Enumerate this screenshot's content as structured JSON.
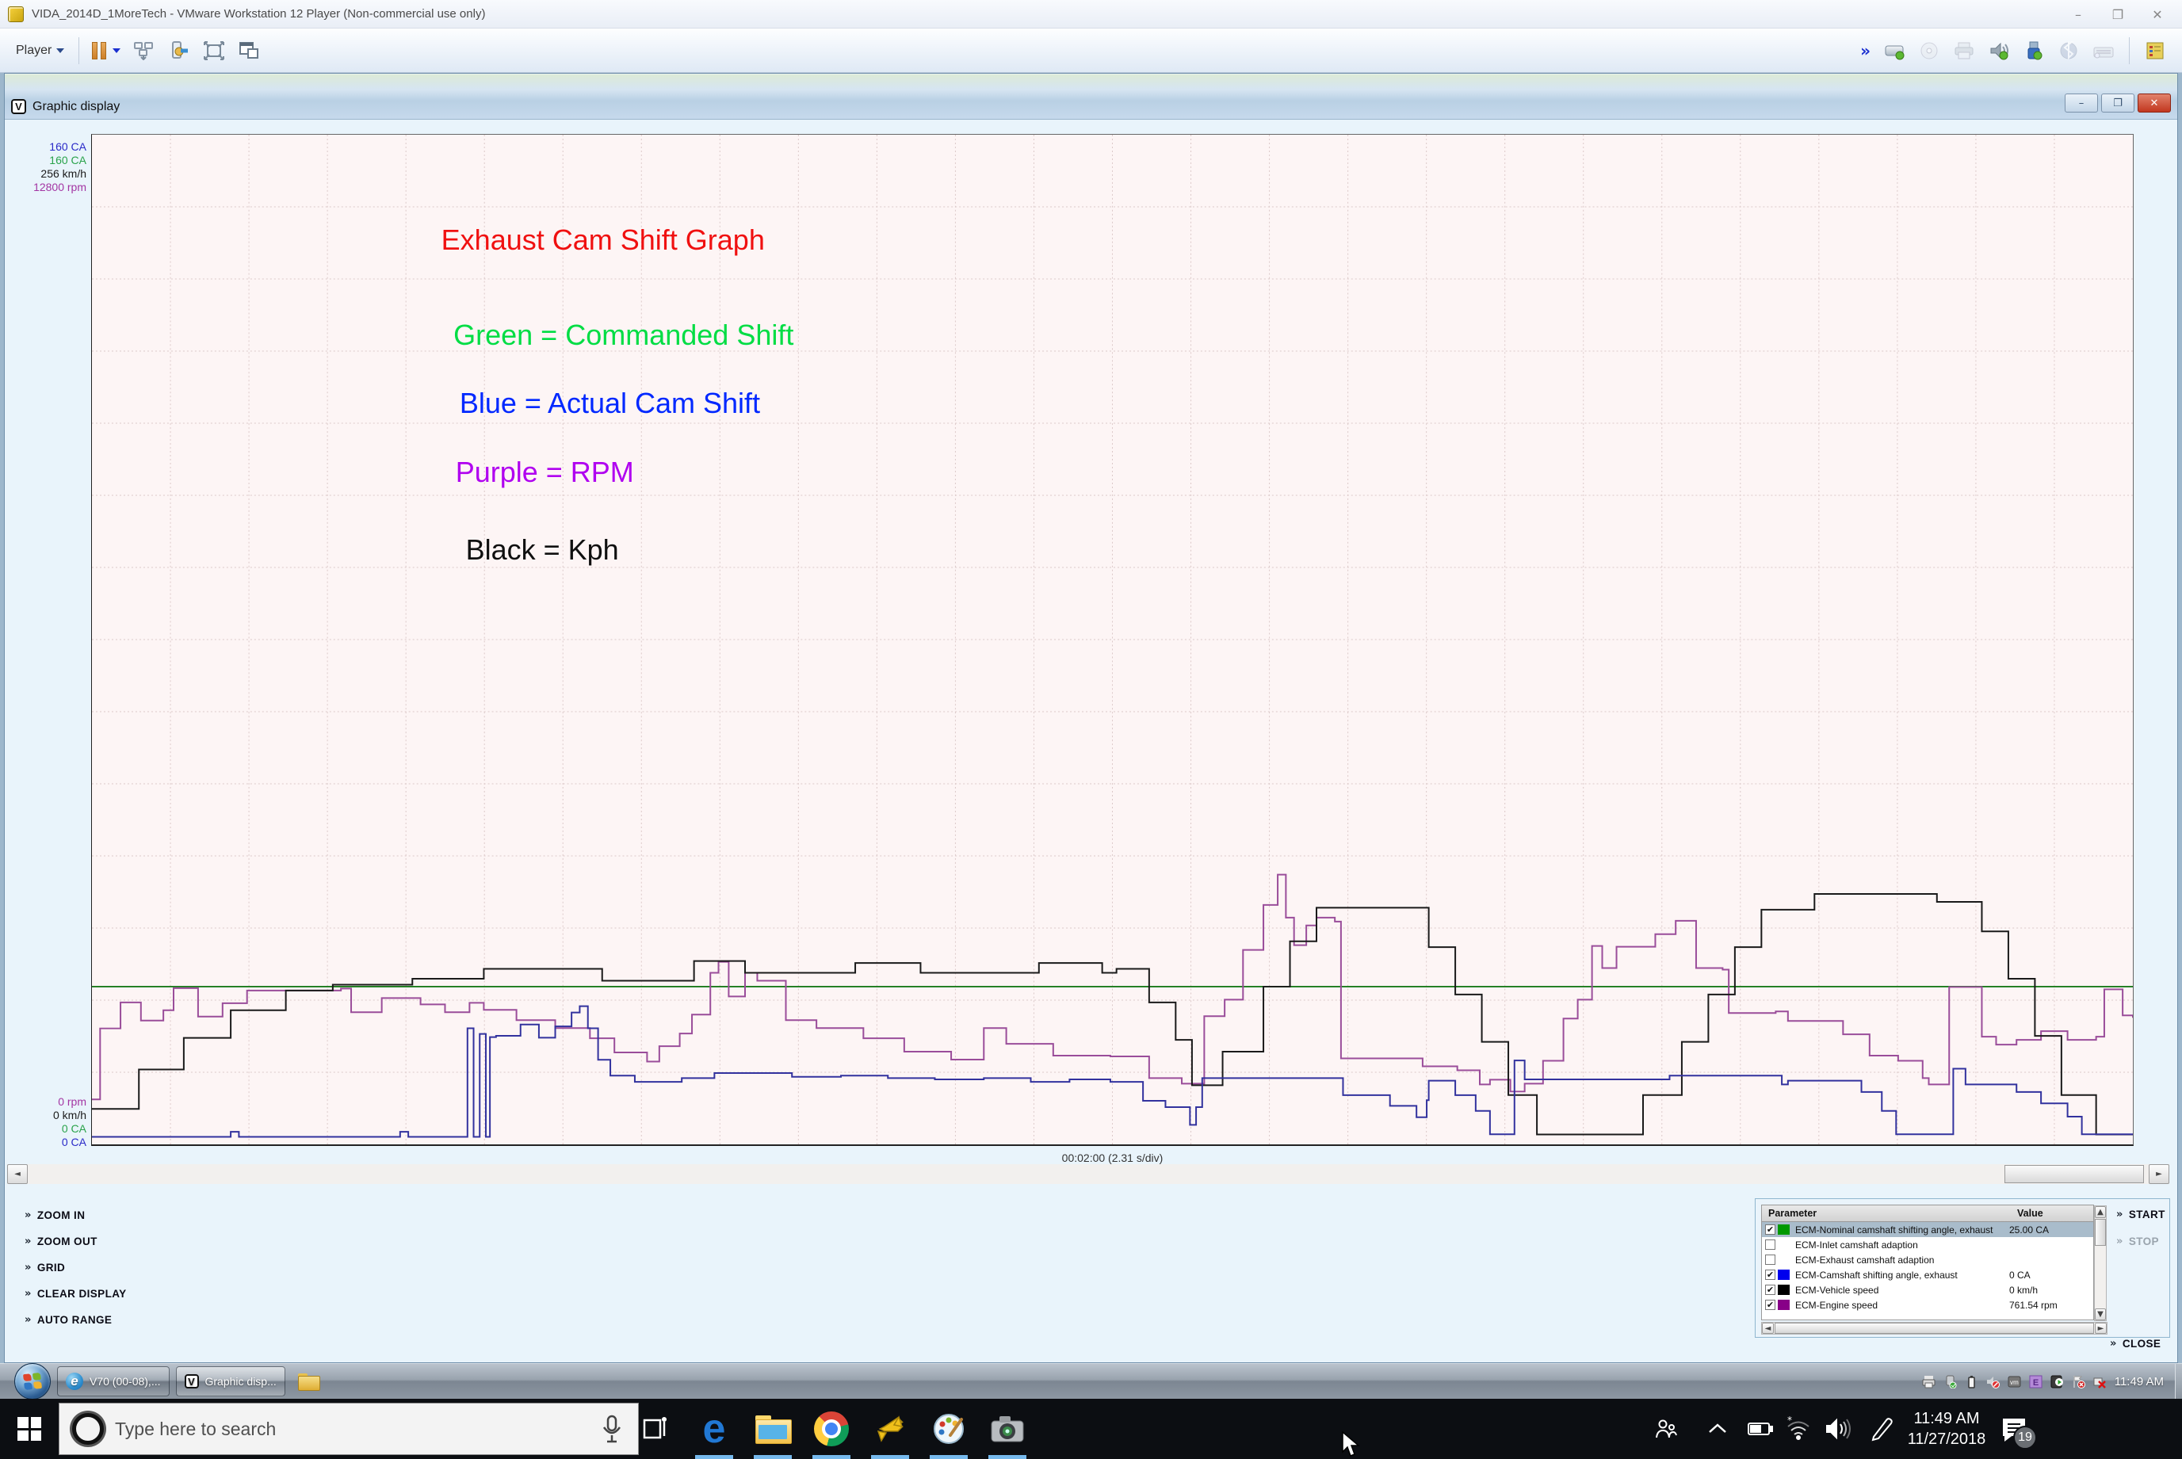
{
  "vmware": {
    "title": "VIDA_2014D_1MoreTech - VMware Workstation 12 Player (Non-commercial use only)",
    "menu_label": "Player",
    "window_controls": {
      "minimize": "–",
      "maximize": "❐",
      "close": "✕"
    },
    "toolbar_icons": [
      "pause-icon",
      "ctrl-alt-del-icon",
      "devices-icon",
      "fullscreen-icon",
      "unity-icon",
      "expand-toolbar-icon",
      "hard-disk-icon",
      "cd-icon",
      "printer-icon",
      "sound-icon",
      "usb-icon",
      "bluetooth-icon",
      "keyboard-icon",
      "tools-note-icon"
    ]
  },
  "graphic_display": {
    "title": "Graphic display",
    "window_controls": {
      "minimize": "–",
      "restore": "❐",
      "close": "✕"
    },
    "axis_top": [
      {
        "text": "160 CA",
        "color": "#2a2ac8"
      },
      {
        "text": "160 CA",
        "color": "#2aa34b"
      },
      {
        "text": "256 km/h",
        "color": "#1a1a1a"
      },
      {
        "text": "12800 rpm",
        "color": "#a335a3"
      }
    ],
    "axis_bottom": [
      {
        "text": "0 rpm",
        "color": "#a335a3"
      },
      {
        "text": "0 km/h",
        "color": "#1a1a1a"
      },
      {
        "text": "0 CA",
        "color": "#2aa34b"
      },
      {
        "text": "0 CA",
        "color": "#2a2ac8"
      }
    ],
    "x_caption": "00:02:00 (2.31 s/div)",
    "buttons": [
      "ZOOM IN",
      "ZOOM OUT",
      "GRID",
      "CLEAR DISPLAY",
      "AUTO RANGE"
    ],
    "start_label": "START",
    "stop_label": "STOP",
    "close_label": "CLOSE",
    "table": {
      "headers": [
        "Parameter",
        "Value"
      ],
      "rows": [
        {
          "checked": true,
          "swatch": "#009900",
          "param": "ECM-Nominal camshaft shifting angle, exhaust",
          "value": "25.00 CA",
          "selected": true
        },
        {
          "checked": false,
          "swatch": null,
          "param": "ECM-Inlet camshaft adaption",
          "value": "",
          "selected": false
        },
        {
          "checked": false,
          "swatch": null,
          "param": "ECM-Exhaust camshaft adaption",
          "value": "",
          "selected": false
        },
        {
          "checked": true,
          "swatch": "#0000ee",
          "param": "ECM-Camshaft shifting angle, exhaust",
          "value": "0 CA",
          "selected": false
        },
        {
          "checked": true,
          "swatch": "#000000",
          "param": "ECM-Vehicle speed",
          "value": "0 km/h",
          "selected": false
        },
        {
          "checked": true,
          "swatch": "#880088",
          "param": "ECM-Engine speed",
          "value": "761.54 rpm",
          "selected": false
        }
      ]
    }
  },
  "chart_data": {
    "type": "line",
    "title": "Exhaust Cam Shift Graph",
    "x_caption": "00:02:00 (2.31 s/div)",
    "seconds_per_div": 2.31,
    "grid": {
      "on": true,
      "cols": 26,
      "rows": 14
    },
    "background": "#fdf5f5",
    "axes": [
      {
        "unit": "CA",
        "min": 0,
        "max": 160,
        "color": "#2a2ac8"
      },
      {
        "unit": "CA",
        "min": 0,
        "max": 160,
        "color": "#2aa34b"
      },
      {
        "unit": "km/h",
        "min": 0,
        "max": 256,
        "color": "#1a1a1a"
      },
      {
        "unit": "rpm",
        "min": 0,
        "max": 12800,
        "color": "#a335a3"
      }
    ],
    "annotations": [
      {
        "text": "Exhaust Cam Shift Graph",
        "color": "#f01010",
        "x": 0.171,
        "y": 0.088
      },
      {
        "text": "Green = Commanded Shift",
        "color": "#00dd44",
        "x": 0.177,
        "y": 0.182
      },
      {
        "text": "Blue = Actual Cam Shift",
        "color": "#0028ff",
        "x": 0.18,
        "y": 0.249
      },
      {
        "text": "Purple = RPM",
        "color": "#b000f0",
        "x": 0.178,
        "y": 0.317
      },
      {
        "text": "Black = Kph",
        "color": "#101010",
        "x": 0.183,
        "y": 0.394
      }
    ],
    "series": [
      {
        "name": "ECM-Nominal camshaft shifting angle, exhaust",
        "unit": "CA",
        "max": 160,
        "color": "#1a7a1a",
        "step": false,
        "points": [
          [
            0,
            25
          ],
          [
            1,
            25
          ]
        ]
      },
      {
        "name": "ECM-Engine speed",
        "unit": "rpm",
        "max": 12800,
        "color": "#9a4d9a",
        "step": true,
        "points": [
          [
            0,
            570
          ],
          [
            0.004,
            1470
          ],
          [
            0.014,
            1800
          ],
          [
            0.024,
            1570
          ],
          [
            0.035,
            1700
          ],
          [
            0.04,
            1980
          ],
          [
            0.052,
            1620
          ],
          [
            0.064,
            1790
          ],
          [
            0.076,
            1950
          ],
          [
            0.122,
            1975
          ],
          [
            0.127,
            1675
          ],
          [
            0.142,
            1855
          ],
          [
            0.161,
            1775
          ],
          [
            0.173,
            1675
          ],
          [
            0.185,
            1795
          ],
          [
            0.192,
            1705
          ],
          [
            0.208,
            1575
          ],
          [
            0.227,
            1475
          ],
          [
            0.244,
            1345
          ],
          [
            0.256,
            1165
          ],
          [
            0.272,
            1050
          ],
          [
            0.278,
            1245
          ],
          [
            0.288,
            1405
          ],
          [
            0.294,
            1645
          ],
          [
            0.303,
            2175
          ],
          [
            0.307,
            2315
          ],
          [
            0.312,
            1875
          ],
          [
            0.32,
            2175
          ],
          [
            0.326,
            2075
          ],
          [
            0.34,
            1575
          ],
          [
            0.355,
            1475
          ],
          [
            0.378,
            1345
          ],
          [
            0.398,
            1175
          ],
          [
            0.421,
            1075
          ],
          [
            0.437,
            1475
          ],
          [
            0.448,
            1275
          ],
          [
            0.471,
            1125
          ],
          [
            0.499,
            1115
          ],
          [
            0.518,
            840
          ],
          [
            0.534,
            770
          ],
          [
            0.545,
            1625
          ],
          [
            0.555,
            1835
          ],
          [
            0.564,
            2465
          ],
          [
            0.574,
            3035
          ],
          [
            0.581,
            3420
          ],
          [
            0.585,
            2875
          ],
          [
            0.589,
            2525
          ],
          [
            0.595,
            2775
          ],
          [
            0.6,
            2875
          ],
          [
            0.609,
            2825
          ],
          [
            0.612,
            1090
          ],
          [
            0.638,
            1090
          ],
          [
            0.652,
            990
          ],
          [
            0.669,
            940
          ],
          [
            0.68,
            760
          ],
          [
            0.685,
            820
          ],
          [
            0.695,
            670
          ],
          [
            0.702,
            770
          ],
          [
            0.711,
            1060
          ],
          [
            0.721,
            1595
          ],
          [
            0.728,
            1835
          ],
          [
            0.735,
            2515
          ],
          [
            0.74,
            2235
          ],
          [
            0.747,
            2505
          ],
          [
            0.766,
            2665
          ],
          [
            0.776,
            2835
          ],
          [
            0.782,
            2835
          ],
          [
            0.786,
            2235
          ],
          [
            0.799,
            2215
          ],
          [
            0.802,
            1665
          ],
          [
            0.825,
            1685
          ],
          [
            0.831,
            1565
          ],
          [
            0.858,
            1395
          ],
          [
            0.871,
            1125
          ],
          [
            0.885,
            1060
          ],
          [
            0.897,
            840
          ],
          [
            0.9,
            760
          ],
          [
            0.91,
            1995
          ],
          [
            0.923,
            1995
          ],
          [
            0.926,
            1365
          ],
          [
            0.933,
            1265
          ],
          [
            0.943,
            1325
          ],
          [
            0.955,
            1435
          ],
          [
            0.968,
            1325
          ],
          [
            0.982,
            1365
          ],
          [
            0.986,
            1965
          ],
          [
            0.995,
            1635
          ],
          [
            1,
            1605
          ]
        ]
      },
      {
        "name": "ECM-Vehicle speed",
        "unit": "km/h",
        "max": 256,
        "color": "#1a1a1a",
        "step": true,
        "points": [
          [
            0,
            9
          ],
          [
            0.023,
            19
          ],
          [
            0.045,
            27
          ],
          [
            0.068,
            34
          ],
          [
            0.095,
            39
          ],
          [
            0.118,
            40.5
          ],
          [
            0.157,
            42
          ],
          [
            0.192,
            44.5
          ],
          [
            0.239,
            44.5
          ],
          [
            0.25,
            41.5
          ],
          [
            0.283,
            41.5
          ],
          [
            0.295,
            46.5
          ],
          [
            0.307,
            46.5
          ],
          [
            0.32,
            43.5
          ],
          [
            0.363,
            43.5
          ],
          [
            0.374,
            46
          ],
          [
            0.398,
            46
          ],
          [
            0.406,
            43.5
          ],
          [
            0.456,
            43.5
          ],
          [
            0.464,
            46
          ],
          [
            0.483,
            46
          ],
          [
            0.495,
            43.5
          ],
          [
            0.502,
            44.5
          ],
          [
            0.518,
            36
          ],
          [
            0.531,
            26.5
          ],
          [
            0.539,
            15
          ],
          [
            0.554,
            23.5
          ],
          [
            0.574,
            40
          ],
          [
            0.587,
            51.5
          ],
          [
            0.6,
            60
          ],
          [
            0.639,
            60
          ],
          [
            0.655,
            50
          ],
          [
            0.668,
            38
          ],
          [
            0.681,
            26
          ],
          [
            0.694,
            12.5
          ],
          [
            0.708,
            2.5
          ],
          [
            0.747,
            2.5
          ],
          [
            0.76,
            12.5
          ],
          [
            0.779,
            26
          ],
          [
            0.792,
            38
          ],
          [
            0.805,
            50
          ],
          [
            0.818,
            59.5
          ],
          [
            0.844,
            63.5
          ],
          [
            0.9,
            63.5
          ],
          [
            0.904,
            61.5
          ],
          [
            0.913,
            61.5
          ],
          [
            0.926,
            54
          ],
          [
            0.939,
            42
          ],
          [
            0.952,
            27.5
          ],
          [
            0.965,
            12.5
          ],
          [
            0.982,
            2.5
          ],
          [
            1,
            2.5
          ]
        ]
      },
      {
        "name": "ECM-Camshaft shifting angle, exhaust",
        "unit": "CA",
        "max": 160,
        "color": "#32329e",
        "step": true,
        "points": [
          [
            0,
            1.2
          ],
          [
            0.065,
            1.2
          ],
          [
            0.068,
            2
          ],
          [
            0.072,
            1.2
          ],
          [
            0.147,
            1.2
          ],
          [
            0.151,
            2
          ],
          [
            0.155,
            1.2
          ],
          [
            0.183,
            1.2
          ],
          [
            0.184,
            18.4
          ],
          [
            0.186,
            18.4
          ],
          [
            0.187,
            1.2
          ],
          [
            0.189,
            1.2
          ],
          [
            0.19,
            17.5
          ],
          [
            0.192,
            17.5
          ],
          [
            0.193,
            1.2
          ],
          [
            0.194,
            1.2
          ],
          [
            0.195,
            17
          ],
          [
            0.198,
            17.2
          ],
          [
            0.203,
            17.2
          ],
          [
            0.21,
            19
          ],
          [
            0.219,
            16.9
          ],
          [
            0.227,
            18.7
          ],
          [
            0.235,
            20.9
          ],
          [
            0.239,
            21.9
          ],
          [
            0.243,
            18.4
          ],
          [
            0.248,
            13.4
          ],
          [
            0.254,
            10.9
          ],
          [
            0.266,
            9.9
          ],
          [
            0.289,
            10.5
          ],
          [
            0.305,
            11.3
          ],
          [
            0.328,
            11.3
          ],
          [
            0.343,
            10.7
          ],
          [
            0.367,
            10.9
          ],
          [
            0.39,
            10.5
          ],
          [
            0.413,
            10.3
          ],
          [
            0.437,
            10.5
          ],
          [
            0.46,
            9.9
          ],
          [
            0.479,
            10.3
          ],
          [
            0.499,
            9.9
          ],
          [
            0.515,
            6.9
          ],
          [
            0.526,
            5.9
          ],
          [
            0.538,
            3.1
          ],
          [
            0.541,
            5.9
          ],
          [
            0.544,
            10.5
          ],
          [
            0.587,
            10.5
          ],
          [
            0.613,
            7.8
          ],
          [
            0.636,
            6.1
          ],
          [
            0.649,
            4.3
          ],
          [
            0.654,
            7
          ],
          [
            0.655,
            10.1
          ],
          [
            0.668,
            7.8
          ],
          [
            0.678,
            5.3
          ],
          [
            0.685,
            1.6
          ],
          [
            0.694,
            1.6
          ],
          [
            0.697,
            13.3
          ],
          [
            0.7,
            13.3
          ],
          [
            0.702,
            10.3
          ],
          [
            0.773,
            10.9
          ],
          [
            0.825,
            10.9
          ],
          [
            0.828,
            9.5
          ],
          [
            0.831,
            10.1
          ],
          [
            0.858,
            10.1
          ],
          [
            0.867,
            8.3
          ],
          [
            0.877,
            5.3
          ],
          [
            0.884,
            1.6
          ],
          [
            0.91,
            1.6
          ],
          [
            0.912,
            12
          ],
          [
            0.916,
            12
          ],
          [
            0.918,
            9.5
          ],
          [
            0.93,
            9.5
          ],
          [
            0.943,
            8.3
          ],
          [
            0.955,
            6.5
          ],
          [
            0.968,
            4.4
          ],
          [
            0.975,
            1.6
          ],
          [
            1,
            1.6
          ]
        ]
      }
    ]
  },
  "vm_taskbar": {
    "tasks": [
      {
        "label": "V70 (00-08),...",
        "icon": "ie-icon",
        "active": false
      },
      {
        "label": "Graphic disp...",
        "icon": "vida-icon",
        "active": true
      }
    ],
    "tray_icons": [
      "printer-icon",
      "usb-icon",
      "battery-icon",
      "mute-icon",
      "vmware-tools-icon",
      "vida-e-icon",
      "vida-play-icon",
      "flag-icon",
      "disconnect-icon"
    ],
    "clock": "11:49 AM"
  },
  "host_taskbar": {
    "search_placeholder": "Type here to search",
    "app_icons": [
      "task-view-icon",
      "edge-icon",
      "file-explorer-icon",
      "chrome-icon",
      "vmware-icon",
      "paint-icon",
      "camera-icon"
    ],
    "tray_icons": [
      "people-icon",
      "chevron-up-icon",
      "battery-icon",
      "wifi-icon",
      "volume-icon",
      "pen-icon"
    ],
    "clock_time": "11:49 AM",
    "clock_date": "11/27/2018",
    "notification_count": "19"
  }
}
